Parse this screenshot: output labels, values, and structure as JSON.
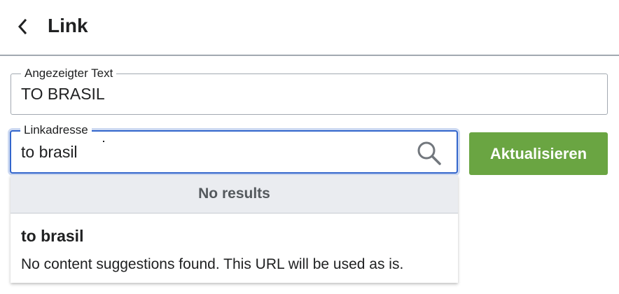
{
  "header": {
    "back_icon": "chevron-left-icon",
    "title": "Link"
  },
  "display_text": {
    "label": "Angezeigter Text",
    "value": "TO BRASIL"
  },
  "link_address": {
    "label": "Linkadresse",
    "value": "to brasil",
    "search_icon": "search-icon"
  },
  "update_button": {
    "label": "Aktualisieren",
    "color": "#6aa542"
  },
  "dropdown": {
    "no_results": "No results",
    "suggestion": {
      "title": "to brasil",
      "description": "No content suggestions found. This URL will be used as is."
    }
  },
  "colors": {
    "focus_border": "#3366cc",
    "accent_green": "#6aa542"
  }
}
